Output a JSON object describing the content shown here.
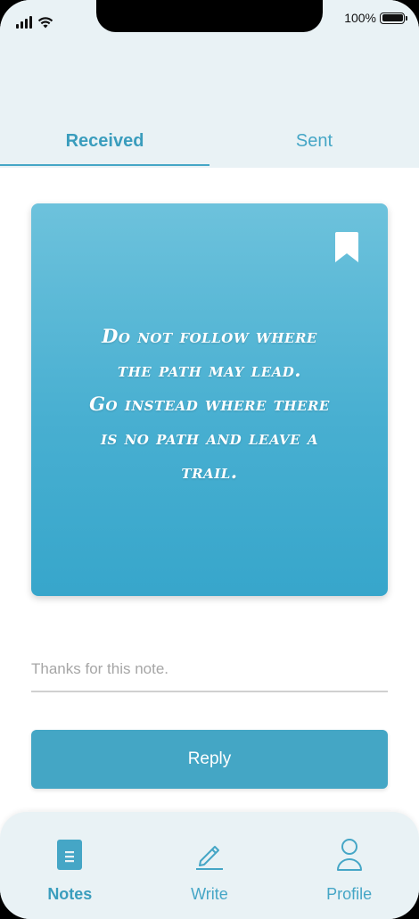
{
  "status_bar": {
    "battery_text": "100%"
  },
  "tabs": [
    {
      "label": "Received",
      "active": true
    },
    {
      "label": "Sent",
      "active": false
    }
  ],
  "note": {
    "quote": "Do not follow where\nthe path may lead.\nGo instead where there\nis no path and leave a\ntrail.",
    "bookmark_icon": "bookmark-icon"
  },
  "reply": {
    "placeholder": "Thanks for this note.",
    "button_label": "Reply"
  },
  "bottom_nav": {
    "items": [
      {
        "label": "Notes",
        "icon": "notes-icon",
        "active": true
      },
      {
        "label": "Write",
        "icon": "pencil-icon",
        "active": false
      },
      {
        "label": "Profile",
        "icon": "profile-icon",
        "active": false
      }
    ]
  },
  "colors": {
    "accent": "#45a6c6",
    "card_top": "#6dc2dc",
    "card_bottom": "#37a6cb",
    "header_bg": "#e9f2f5"
  }
}
